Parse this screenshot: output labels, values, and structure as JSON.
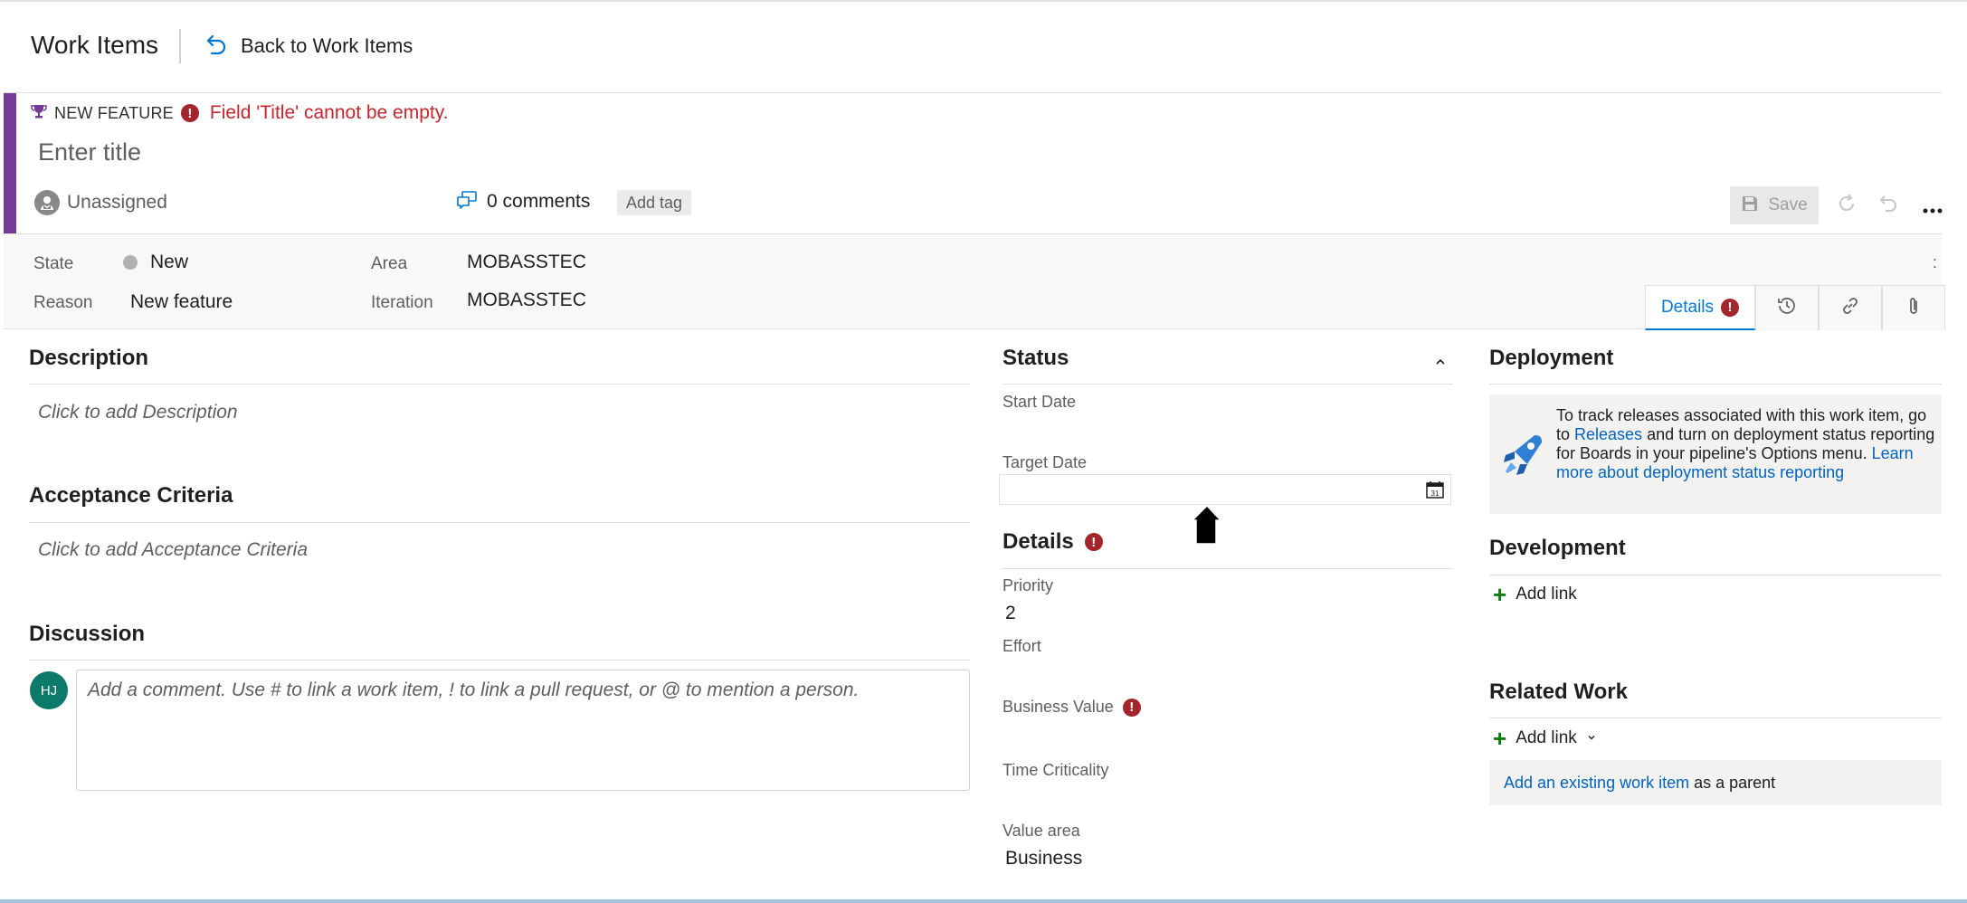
{
  "header": {
    "title": "Work Items",
    "back_label": "Back to Work Items"
  },
  "work_item": {
    "type_label": "NEW FEATURE",
    "error_message": "Field 'Title' cannot be empty.",
    "title_placeholder": "Enter title",
    "assignee": "Unassigned",
    "comments_label": "0 comments",
    "add_tag_label": "Add tag",
    "save_label": "Save",
    "accent_color": "#773b93"
  },
  "fields": {
    "state_label": "State",
    "state_value": "New",
    "reason_label": "Reason",
    "reason_value": "New feature",
    "area_label": "Area",
    "area_value": "MOBASSTEC",
    "iteration_label": "Iteration",
    "iteration_value": "MOBASSTEC",
    "kebab": ":"
  },
  "tabs": {
    "details_label": "Details",
    "icons": [
      "history-icon",
      "link-icon",
      "attachment-icon"
    ]
  },
  "description": {
    "title": "Description",
    "placeholder": "Click to add Description"
  },
  "acceptance": {
    "title": "Acceptance Criteria",
    "placeholder": "Click to add Acceptance Criteria"
  },
  "discussion": {
    "title": "Discussion",
    "avatar_initials": "HJ",
    "placeholder": "Add a comment. Use # to link a work item, ! to link a pull request, or @ to mention a person."
  },
  "status": {
    "title": "Status",
    "start_date_label": "Start Date",
    "target_date_label": "Target Date",
    "calendar_day": "31"
  },
  "details": {
    "title": "Details",
    "priority_label": "Priority",
    "priority_value": "2",
    "effort_label": "Effort",
    "business_value_label": "Business Value",
    "time_criticality_label": "Time Criticality",
    "value_area_label": "Value area",
    "value_area_value": "Business"
  },
  "deployment": {
    "title": "Deployment",
    "text_1": "To track releases associated with this work item, go to ",
    "releases_link": "Releases",
    "text_2": " and turn on deployment status reporting for Boards in your pipeline's Options menu. ",
    "learn_more_link": "Learn more about deployment status reporting"
  },
  "development": {
    "title": "Development",
    "add_link_label": "Add link"
  },
  "related_work": {
    "title": "Related Work",
    "add_link_label": "Add link",
    "existing_link": "Add an existing work item",
    "parent_suffix": " as a parent"
  }
}
